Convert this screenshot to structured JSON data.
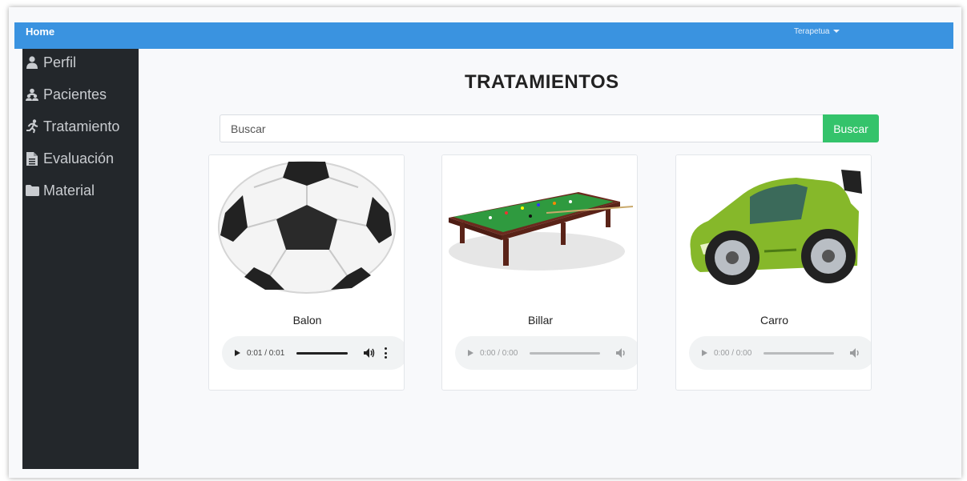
{
  "topbar": {
    "home_label": "Home",
    "user_menu_label": "Terapetua"
  },
  "sidebar": {
    "items": [
      {
        "label": "Perfil",
        "icon": "user-icon"
      },
      {
        "label": "Pacientes",
        "icon": "users-icon"
      },
      {
        "label": "Tratamiento",
        "icon": "running-icon"
      },
      {
        "label": "Evaluación",
        "icon": "document-icon"
      },
      {
        "label": "Material",
        "icon": "folder-icon"
      }
    ]
  },
  "main": {
    "title": "TRATAMIENTOS",
    "search": {
      "placeholder": "Buscar",
      "button_label": "Buscar"
    },
    "cards": [
      {
        "label": "Balon",
        "image": "soccer-ball-image",
        "audio_time": "0:01 / 0:01",
        "progress": 1.0
      },
      {
        "label": "Billar",
        "image": "billiard-table-image",
        "audio_time": "0:00 / 0:00",
        "progress": 0
      },
      {
        "label": "Carro",
        "image": "cartoon-car-image",
        "audio_time": "0:00 / 0:00",
        "progress": 0
      }
    ]
  },
  "colors": {
    "topbar": "#3a93e0",
    "sidebar": "#23272b",
    "search_button": "#34c36b"
  }
}
